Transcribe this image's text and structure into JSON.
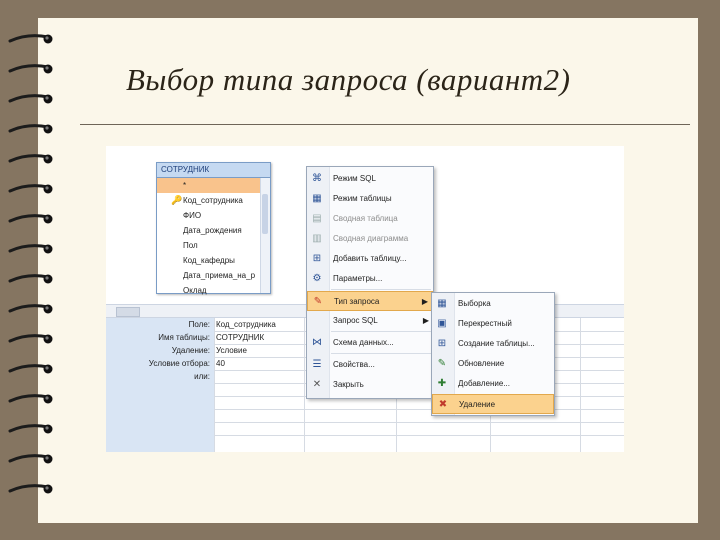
{
  "slide": {
    "title": "Выбор типа запроса (вариант2)"
  },
  "table": {
    "name": "СОТРУДНИК",
    "fields": [
      {
        "label": "*",
        "key": false,
        "selected": true
      },
      {
        "label": "Код_сотрудника",
        "key": true,
        "selected": false
      },
      {
        "label": "ФИО",
        "key": false,
        "selected": false
      },
      {
        "label": "Дата_рождения",
        "key": false,
        "selected": false
      },
      {
        "label": "Пол",
        "key": false,
        "selected": false
      },
      {
        "label": "Код_кафедры",
        "key": false,
        "selected": false
      },
      {
        "label": "Дата_приема_на_р",
        "key": false,
        "selected": false
      },
      {
        "label": "Оклад",
        "key": false,
        "selected": false
      }
    ]
  },
  "grid": {
    "row_labels": [
      "Поле:",
      "Имя таблицы:",
      "Удаление:",
      "Условие отбора:",
      "или:"
    ],
    "values": [
      "Код_сотрудника",
      "СОТРУДНИК",
      "Условие",
      "40",
      ""
    ]
  },
  "context_menu": {
    "items": [
      {
        "label": "Режим SQL",
        "icon": "sql-icon",
        "disabled": false,
        "submenu": false,
        "highlight": false
      },
      {
        "label": "Режим таблицы",
        "icon": "datasheet-icon",
        "disabled": false,
        "submenu": false,
        "highlight": false
      },
      {
        "label": "Сводная таблица",
        "icon": "pivot-table-icon",
        "disabled": true,
        "submenu": false,
        "highlight": false
      },
      {
        "label": "Сводная диаграмма",
        "icon": "pivot-chart-icon",
        "disabled": true,
        "submenu": false,
        "highlight": false
      },
      {
        "label": "Добавить таблицу...",
        "icon": "add-table-icon",
        "disabled": false,
        "submenu": false,
        "highlight": false
      },
      {
        "label": "Параметры...",
        "icon": "parameters-icon",
        "disabled": false,
        "submenu": false,
        "highlight": false
      },
      {
        "label": "Тип запроса",
        "icon": "query-type-icon",
        "disabled": false,
        "submenu": true,
        "highlight": true
      },
      {
        "label": "Запрос SQL",
        "icon": "",
        "disabled": false,
        "submenu": true,
        "highlight": false
      },
      {
        "label": "Схема данных...",
        "icon": "relationships-icon",
        "disabled": false,
        "submenu": false,
        "highlight": false
      },
      {
        "label": "Свойства...",
        "icon": "properties-icon",
        "disabled": false,
        "submenu": false,
        "highlight": false
      },
      {
        "label": "Закрыть",
        "icon": "close-icon",
        "disabled": false,
        "submenu": false,
        "highlight": false
      }
    ]
  },
  "submenu": {
    "items": [
      {
        "label": "Выборка",
        "icon": "select-query-icon",
        "highlight": false
      },
      {
        "label": "Перекрестный",
        "icon": "crosstab-icon",
        "highlight": false
      },
      {
        "label": "Создание таблицы...",
        "icon": "make-table-icon",
        "highlight": false
      },
      {
        "label": "Обновление",
        "icon": "update-icon",
        "highlight": false
      },
      {
        "label": "Добавление...",
        "icon": "append-icon",
        "highlight": false
      },
      {
        "label": "Удаление",
        "icon": "delete-query-icon",
        "highlight": true
      }
    ]
  }
}
